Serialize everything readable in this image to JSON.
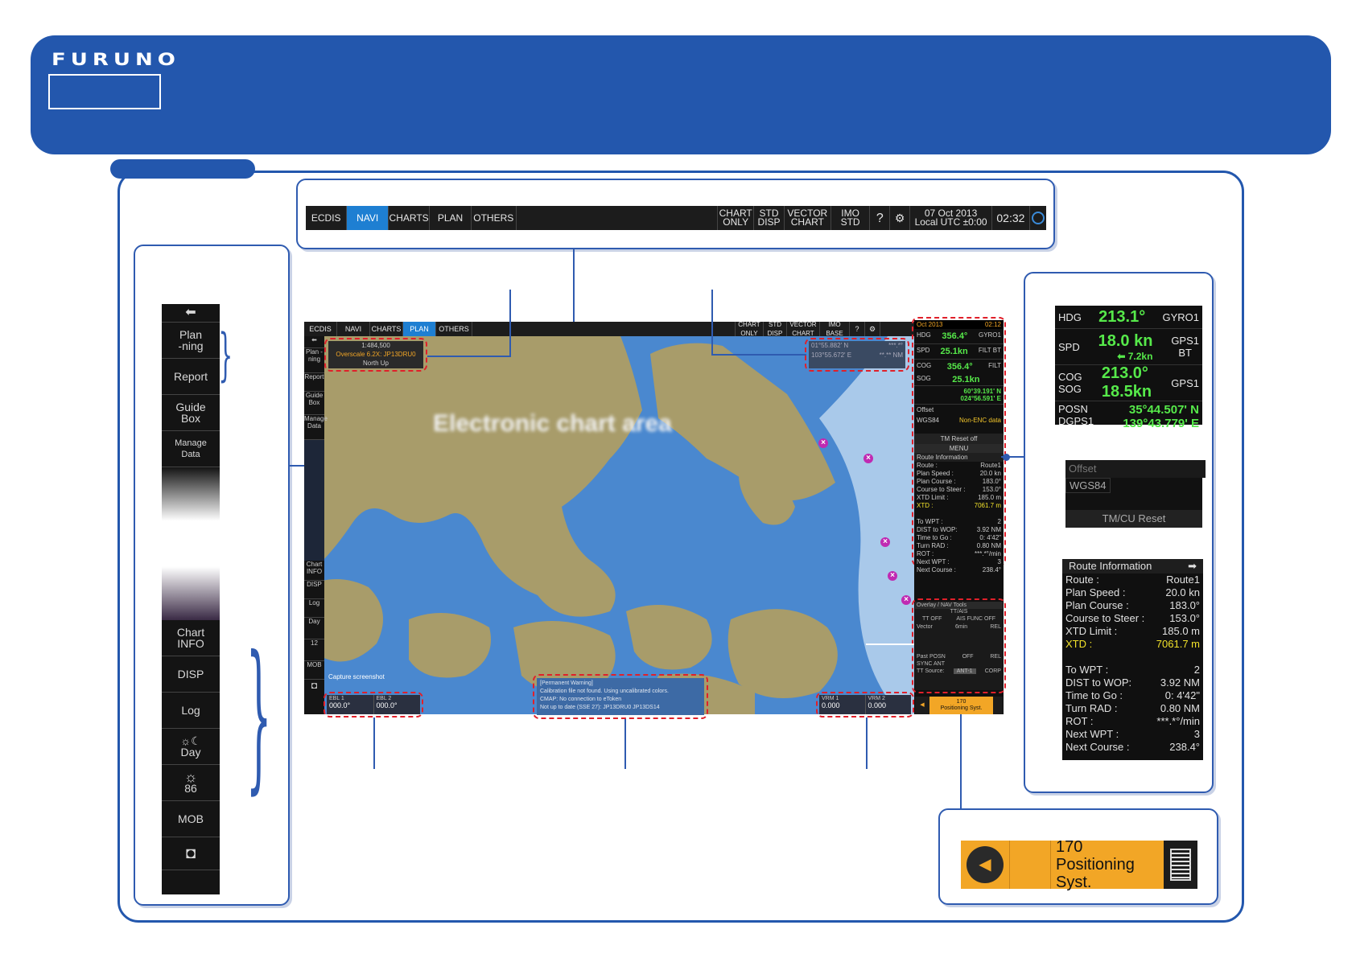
{
  "brand": {
    "logo": "FURUNO",
    "accent": "#2357ad",
    "alert_color": "#e0202a"
  },
  "top_toolbar": {
    "tabs": [
      "ECDIS",
      "NAVI",
      "CHARTS",
      "PLAN",
      "OTHERS"
    ],
    "active_tab": "NAVI",
    "right_buttons": [
      {
        "l1": "CHART",
        "l2": "ONLY"
      },
      {
        "l1": "STD",
        "l2": "DISP"
      },
      {
        "l1": "VECTOR",
        "l2": "CHART"
      },
      {
        "l1": "IMO",
        "l2": "STD"
      }
    ],
    "date": "07 Oct 2013",
    "local": "Local UTC ±0:00",
    "time": "02:32",
    "help_icon": "help-icon",
    "settings_icon": "gear-icon"
  },
  "left_panel": {
    "back_icon": "arrow-left-icon",
    "items_top": [
      {
        "l1": "Plan",
        "l2": "-ning"
      },
      {
        "l1": "Report",
        "l2": ""
      },
      {
        "l1": "Guide",
        "l2": "Box"
      },
      {
        "l1": "Manage",
        "l2": "Data"
      }
    ],
    "items_bottom": [
      {
        "l1": "Chart",
        "l2": "INFO"
      },
      {
        "l1": "DISP",
        "l2": ""
      },
      {
        "l1": "Log",
        "l2": ""
      },
      {
        "l1": "Day",
        "l2": ""
      },
      {
        "l1": "86",
        "l2": ""
      },
      {
        "l1": "MOB",
        "l2": ""
      }
    ],
    "camera_icon": "camera-icon"
  },
  "screen": {
    "tabs": [
      "ECDIS",
      "NAVI",
      "CHARTS",
      "PLAN",
      "OTHERS"
    ],
    "active_tab": "PLAN",
    "right_buttons": [
      "CHART ONLY",
      "STD DISP",
      "VECTOR CHART",
      "IMO BASE"
    ],
    "chart_area_label": "Electronic chart area",
    "scale": "1:484,500",
    "overscale": "Overscale 6.2X: JP13DRU0",
    "orientation": "North Up",
    "cursor": {
      "lat": "01°55.882' N",
      "lon": "103°55.672' E",
      "rng": "***.*°",
      "brg": "**.** NM"
    },
    "side": {
      "plan": "Plan -ning",
      "report": "Report",
      "guide": "Guide Box",
      "manage": "Manage Data",
      "chart_info": "Chart INFO",
      "disp": "DISP",
      "log": "Log",
      "day": "Day",
      "bright": "12",
      "mob": "MOB",
      "capture": "Capture screenshot"
    },
    "sensor": {
      "date": "Oct 2013",
      "utc": "UTC",
      "time": "02:12",
      "hdg": "356.4°",
      "hdg_src": "GYRO1",
      "spd": "25.1kn",
      "spd2": "0.0kn",
      "spd_src": "FILT BT",
      "cog": "356.4°",
      "sog": "25.1kn",
      "cog_src": "FILT",
      "posn_lat": "60°39.191' N",
      "posn_lon": "024°56.591' E",
      "posn_src": "POSN FILT",
      "offset": "Offset",
      "datum": "WGS84",
      "datum_note": "Non-ENC data",
      "tm_reset": "TM Reset off",
      "menu": "MENU"
    },
    "route": {
      "title": "Route Information",
      "rows": [
        [
          "Route :",
          "Route1"
        ],
        [
          "Plan Speed :",
          "20.0 kn"
        ],
        [
          "Plan Course :",
          "183.0°"
        ],
        [
          "Course to Steer :",
          "153.0°"
        ],
        [
          "XTD Limit :",
          "185.0 m"
        ],
        [
          "XTD :",
          "7061.7 m"
        ],
        [
          "",
          ""
        ],
        [
          "To WPT :",
          "2"
        ],
        [
          "DIST to WOP:",
          "3.92 NM"
        ],
        [
          "Time to Go :",
          "0: 4'42\""
        ],
        [
          "Turn RAD :",
          "0.80 NM"
        ],
        [
          "ROT :",
          "***.*°/min"
        ],
        [
          "Next WPT :",
          "3"
        ],
        [
          "Next Course :",
          "238.4°"
        ]
      ]
    },
    "overlay": {
      "title": "Overlay / NAV Tools",
      "sub": "TT/AIS",
      "tt": "TT OFF",
      "ais": "AIS FUNC OFF",
      "vector": "Vector",
      "vector_val": "6min",
      "vector_mode": "REL",
      "past": "Past POSN",
      "past_val": "OFF",
      "past_mode": "REL",
      "sync": "SYNC ANT",
      "tt_source": "TT Source:",
      "tt_source_val": "ANT-1",
      "corp": "CORP"
    },
    "ebl": {
      "ebl1": "EBL 1",
      "ebl1_val": "000.0°",
      "ebl2": "EBL 2",
      "ebl2_val": "000.0°",
      "r": "R"
    },
    "vrm": {
      "vrm1": "VRM 1",
      "vrm1_val": "0.000",
      "vrm2": "VRM 2",
      "vrm2_val": "0.000",
      "unit": "NM"
    },
    "warning": {
      "l1": "[Permanent Warning]",
      "l2": "Calibration file not found. Using uncalibrated colors.",
      "l3": "CMAP: No connection to eToken",
      "l4": "Not up to date (SSE 27): JP13DRU0 JP13DS14"
    },
    "alert": {
      "code": "170",
      "text": "Positioning Syst."
    }
  },
  "right_zoom": {
    "hdg": {
      "label": "HDG",
      "val": "213.1°",
      "src": "GYRO1"
    },
    "spd": {
      "label": "SPD",
      "val": "18.0 kn",
      "sub": "7.2kn",
      "src": "GPS1",
      "src2": "BT"
    },
    "cog": {
      "label": "COG",
      "val": "213.0°",
      "src": "GPS1"
    },
    "sog": {
      "label": "SOG",
      "val": "18.5kn"
    },
    "posn": {
      "label": "POSN",
      "src": "DGPS1",
      "lat": "35°44.507' N",
      "lon": "139°43.779' E"
    },
    "offset": "Offset",
    "datum": "WGS84",
    "reset": "TM/CU Reset",
    "route": {
      "title": "Route Information",
      "rows": [
        [
          "Route :",
          "Route1"
        ],
        [
          "Plan Speed :",
          "20.0 kn"
        ],
        [
          "Plan Course :",
          "183.0°"
        ],
        [
          "Course to Steer :",
          "153.0°"
        ],
        [
          "XTD Limit :",
          "185.0 m"
        ],
        [
          "XTD :",
          "7061.7 m"
        ],
        [
          "",
          ""
        ],
        [
          "To WPT :",
          "2"
        ],
        [
          "DIST to WOP:",
          "3.92 NM"
        ],
        [
          "Time to Go :",
          "0: 4'42\""
        ],
        [
          "Turn RAD :",
          "0.80 NM"
        ],
        [
          "ROT :",
          "***.*°/min"
        ],
        [
          "Next WPT :",
          "3"
        ],
        [
          "Next Course :",
          "238.4°"
        ]
      ]
    }
  },
  "alert_zoom": {
    "code": "170",
    "text": "Positioning Syst.",
    "speaker_icon": "speaker-icon",
    "list_icon": "list-icon"
  }
}
